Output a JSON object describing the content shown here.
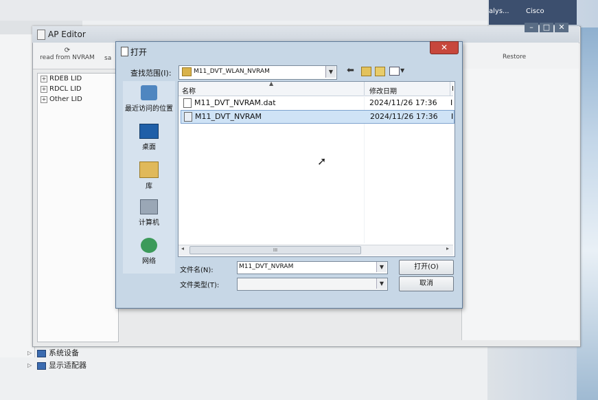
{
  "desktop": {
    "icon_labels": [
      "alys...",
      "Cisco"
    ]
  },
  "device_manager": {
    "items": [
      {
        "label": "系统设备",
        "icon": "system-device-icon"
      },
      {
        "label": "显示适配器",
        "icon": "display-adapter-icon"
      }
    ]
  },
  "ap_editor": {
    "title": "AP Editor",
    "toolbar": {
      "read_label": "read from NVRAM",
      "second_label": "sa",
      "restore_label": "Restore"
    },
    "tree": [
      {
        "label": "RDEB LID"
      },
      {
        "label": "RDCL LID"
      },
      {
        "label": "Other LID"
      }
    ]
  },
  "open_dialog": {
    "title": "打开",
    "close_symbol": "✕",
    "look_in_label": "查找范围(I):",
    "look_in_value": "M11_DVT_WLAN_NVRAM",
    "places": [
      {
        "label": "最近访问的位置",
        "icon": "recent-places-icon"
      },
      {
        "label": "桌面",
        "icon": "desktop-icon"
      },
      {
        "label": "库",
        "icon": "libraries-icon"
      },
      {
        "label": "计算机",
        "icon": "computer-icon"
      },
      {
        "label": "网络",
        "icon": "network-icon"
      }
    ],
    "columns": {
      "name": "名称",
      "date": "修改日期",
      "extra": "I"
    },
    "files": [
      {
        "name": "M11_DVT_NVRAM.dat",
        "date": "2024/11/26 17:36",
        "extra": "I",
        "selected": false
      },
      {
        "name": "M11_DVT_NVRAM",
        "date": "2024/11/26 17:36",
        "extra": "I",
        "selected": true
      }
    ],
    "scroll_grip": "III",
    "file_name_label": "文件名(N):",
    "file_name_value": "M11_DVT_NVRAM",
    "file_type_label": "文件类型(T):",
    "file_type_value": "",
    "open_button": "打开(O)",
    "cancel_button": "取消"
  }
}
